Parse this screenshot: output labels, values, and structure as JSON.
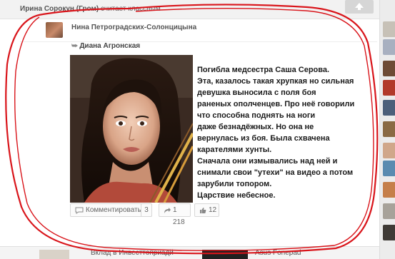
{
  "header": {
    "sharer_name": "Ирина Сорокун (Гром)",
    "sharer_action": "считает классным"
  },
  "post": {
    "author_name": "Нина Петроградских-Солонцицына",
    "repost_from": "Диана Агронская",
    "text_lines": [
      "Погибла медсестра Саша Серова.",
      "Эта, казалось такая хрупкая но сильная",
      "девушка выносила с поля боя",
      "раненых ополченцев. Про неё говорили",
      "что способна поднять на ноги",
      "даже безнадёжных. Но она не",
      "вернулась из боя. Была схвачена",
      "карателями хунты.",
      "Сначала они измывались над ней и",
      "снимали свои \"утехи\" на видео а потом",
      "зарубили топором.",
      "Царствие небесное."
    ]
  },
  "actions": {
    "comment_label": "Комментировать",
    "comment_count": "3",
    "share_count": "1 218",
    "like_count": "12"
  },
  "next_items": {
    "left_title": "Вклад в Инвесттоприадй",
    "right_title": "Asus Fonepad"
  },
  "colors": {
    "annotation_red": "#d9151b",
    "topbar_bg": "#f2f2f2"
  }
}
